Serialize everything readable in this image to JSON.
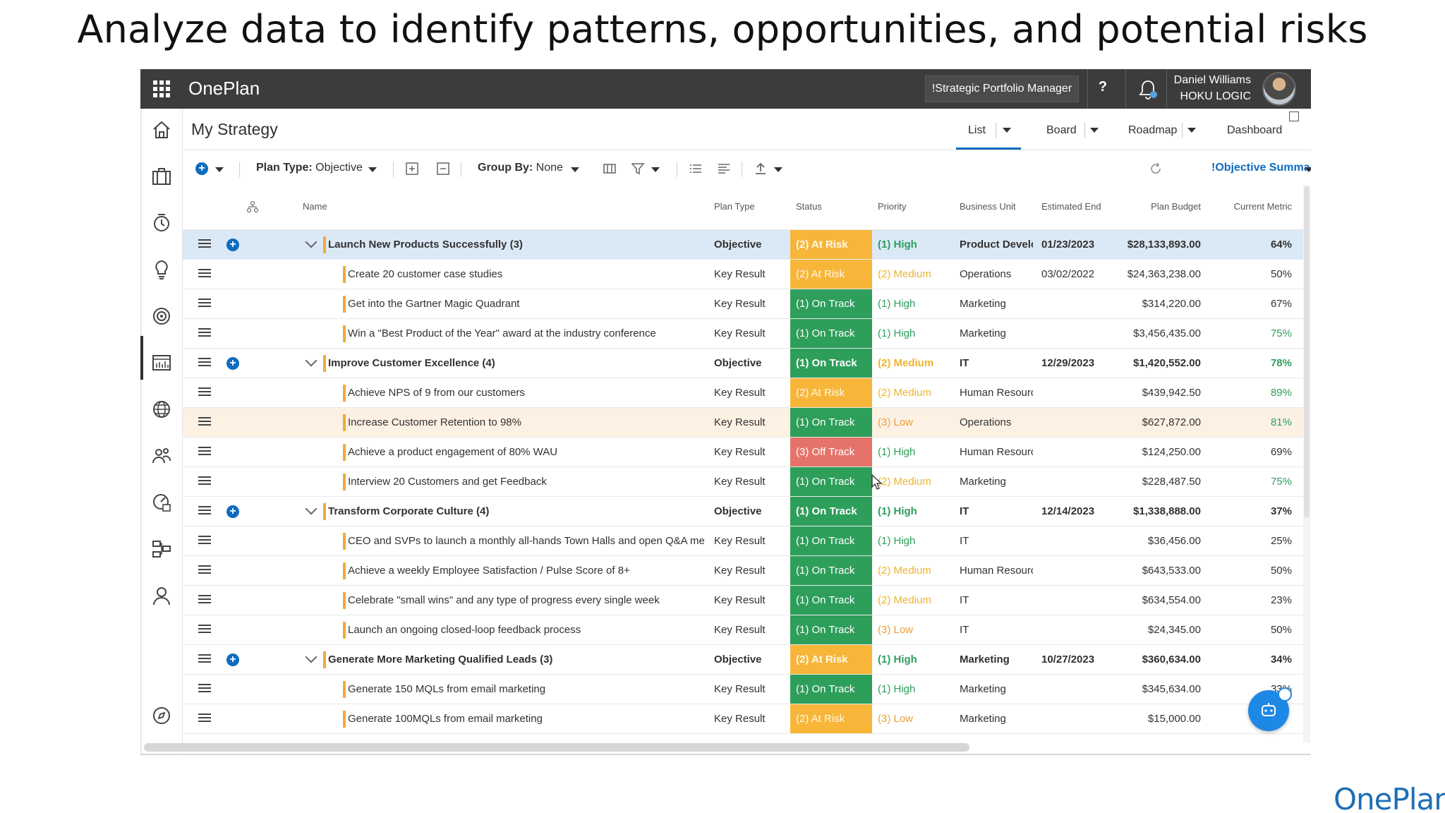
{
  "slide": {
    "title": "Analyze data to identify patterns, opportunities, and potential risks",
    "brand": "OnePlan"
  },
  "topbar": {
    "app_name": "OnePlan",
    "role": "!Strategic Portfolio Manager",
    "help": "?",
    "user_name": "Daniel Williams",
    "user_org": "HOKU LOGIC"
  },
  "page": {
    "title": "My Strategy",
    "views": [
      "List",
      "Board",
      "Roadmap",
      "Dashboard"
    ],
    "active_view": "List"
  },
  "toolbar": {
    "plan_type_label": "Plan Type:",
    "plan_type_value": "Objective",
    "group_by_label": "Group By:",
    "group_by_value": "None",
    "summary": "!Objective Summary"
  },
  "columns": [
    "Name",
    "Plan Type",
    "Status",
    "Priority",
    "Business Unit",
    "Estimated End",
    "Plan Budget",
    "Current Metric"
  ],
  "rows": [
    {
      "level": "objective",
      "name": "Launch New Products Successfully (3)",
      "type": "Objective",
      "status": "(2) At Risk",
      "status_kind": "risk",
      "priority": "(1) High",
      "priority_kind": "high",
      "bu": "Product Develo|",
      "end": "01/23/2023",
      "budget": "$28,133,893.00",
      "metric": "64%",
      "metric_green": false,
      "selected": true
    },
    {
      "level": "kr",
      "name": "Create 20 customer case studies",
      "type": "Key Result",
      "status": "(2) At Risk",
      "status_kind": "risk",
      "priority": "(2) Medium",
      "priority_kind": "med",
      "bu": "Operations",
      "end": "03/02/2022",
      "budget": "$24,363,238.00",
      "metric": "50%",
      "metric_green": false
    },
    {
      "level": "kr",
      "name": "Get into the Gartner Magic Quadrant",
      "type": "Key Result",
      "status": "(1) On Track",
      "status_kind": "track",
      "priority": "(1) High",
      "priority_kind": "high",
      "bu": "Marketing",
      "end": "",
      "budget": "$314,220.00",
      "metric": "67%",
      "metric_green": false
    },
    {
      "level": "kr",
      "name": "Win a \"Best Product of the Year\" award at the industry conference",
      "type": "Key Result",
      "status": "(1) On Track",
      "status_kind": "track",
      "priority": "(1) High",
      "priority_kind": "high",
      "bu": "Marketing",
      "end": "",
      "budget": "$3,456,435.00",
      "metric": "75%",
      "metric_green": true
    },
    {
      "level": "objective",
      "name": "Improve Customer Excellence (4)",
      "type": "Objective",
      "status": "(1) On Track",
      "status_kind": "track",
      "priority": "(2) Medium",
      "priority_kind": "med",
      "bu": "IT",
      "end": "12/29/2023",
      "budget": "$1,420,552.00",
      "metric": "78%",
      "metric_green": true
    },
    {
      "level": "kr",
      "name": "Achieve NPS of 9 from our customers",
      "type": "Key Result",
      "status": "(2) At Risk",
      "status_kind": "risk",
      "priority": "(2) Medium",
      "priority_kind": "med",
      "bu": "Human Resourc",
      "end": "",
      "budget": "$439,942.50",
      "metric": "89%",
      "metric_green": true
    },
    {
      "level": "kr",
      "name": "Increase Customer Retention to 98%",
      "type": "Key Result",
      "status": "(1) On Track",
      "status_kind": "track",
      "priority": "(3) Low",
      "priority_kind": "low",
      "bu": "Operations",
      "end": "",
      "budget": "$627,872.00",
      "metric": "81%",
      "metric_green": true,
      "hover": true
    },
    {
      "level": "kr",
      "name": "Achieve a product engagement of 80% WAU",
      "type": "Key Result",
      "status": "(3) Off Track",
      "status_kind": "off",
      "priority": "(1) High",
      "priority_kind": "high",
      "bu": "Human Resourc",
      "end": "",
      "budget": "$124,250.00",
      "metric": "69%",
      "metric_green": false
    },
    {
      "level": "kr",
      "name": "Interview 20 Customers and get Feedback",
      "type": "Key Result",
      "status": "(1) On Track",
      "status_kind": "track",
      "priority": "(2) Medium",
      "priority_kind": "med",
      "bu": "Marketing",
      "end": "",
      "budget": "$228,487.50",
      "metric": "75%",
      "metric_green": true
    },
    {
      "level": "objective",
      "name": "Transform Corporate Culture (4)",
      "type": "Objective",
      "status": "(1) On Track",
      "status_kind": "track",
      "priority": "(1) High",
      "priority_kind": "high",
      "bu": "IT",
      "end": "12/14/2023",
      "budget": "$1,338,888.00",
      "metric": "37%",
      "metric_green": false
    },
    {
      "level": "kr",
      "name": "CEO and SVPs to launch a monthly all-hands Town Halls and open Q&A me",
      "type": "Key Result",
      "status": "(1) On Track",
      "status_kind": "track",
      "priority": "(1) High",
      "priority_kind": "high",
      "bu": "IT",
      "end": "",
      "budget": "$36,456.00",
      "metric": "25%",
      "metric_green": false
    },
    {
      "level": "kr",
      "name": "Achieve a weekly Employee Satisfaction / Pulse Score of 8+",
      "type": "Key Result",
      "status": "(1) On Track",
      "status_kind": "track",
      "priority": "(2) Medium",
      "priority_kind": "med",
      "bu": "Human Resourc",
      "end": "",
      "budget": "$643,533.00",
      "metric": "50%",
      "metric_green": false
    },
    {
      "level": "kr",
      "name": "Celebrate \"small wins\" and any type of progress every single week",
      "type": "Key Result",
      "status": "(1) On Track",
      "status_kind": "track",
      "priority": "(2) Medium",
      "priority_kind": "med",
      "bu": "IT",
      "end": "",
      "budget": "$634,554.00",
      "metric": "23%",
      "metric_green": false
    },
    {
      "level": "kr",
      "name": "Launch an ongoing closed-loop feedback process",
      "type": "Key Result",
      "status": "(1) On Track",
      "status_kind": "track",
      "priority": "(3) Low",
      "priority_kind": "low",
      "bu": "IT",
      "end": "",
      "budget": "$24,345.00",
      "metric": "50%",
      "metric_green": false
    },
    {
      "level": "objective",
      "name": "Generate More Marketing Qualified Leads (3)",
      "type": "Objective",
      "status": "(2) At Risk",
      "status_kind": "risk",
      "priority": "(1) High",
      "priority_kind": "high",
      "bu": "Marketing",
      "end": "10/27/2023",
      "budget": "$360,634.00",
      "metric": "34%",
      "metric_green": false
    },
    {
      "level": "kr",
      "name": "Generate 150 MQLs from email marketing",
      "type": "Key Result",
      "status": "(1) On Track",
      "status_kind": "track",
      "priority": "(1) High",
      "priority_kind": "high",
      "bu": "Marketing",
      "end": "",
      "budget": "$345,634.00",
      "metric": "33%",
      "metric_green": false
    },
    {
      "level": "kr",
      "name": "Generate 100MQLs from email marketing",
      "type": "Key Result",
      "status": "(2) At Risk",
      "status_kind": "risk",
      "priority": "(3) Low",
      "priority_kind": "low",
      "bu": "Marketing",
      "end": "",
      "budget": "$15,000.00",
      "metric": "",
      "metric_green": false
    }
  ],
  "colors": {
    "topbar": "#3c3c3c",
    "accent": "#0f6cbd",
    "at_risk": "#f7b63a",
    "on_track": "#2e9e5b",
    "off_track": "#e5736a",
    "selected_row": "#dbe9f7",
    "hover_row": "#fdf1e4"
  }
}
